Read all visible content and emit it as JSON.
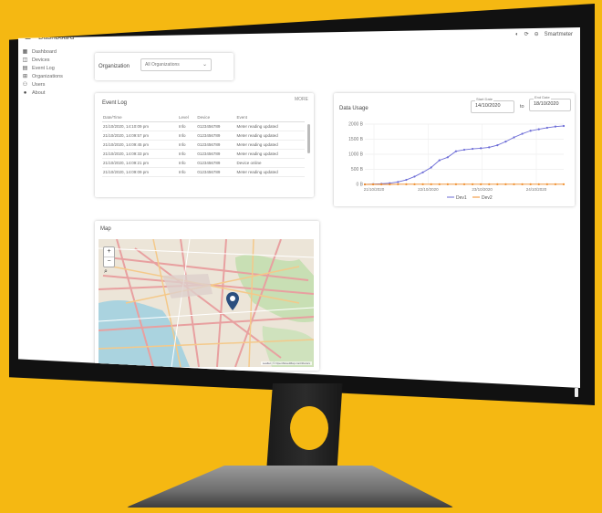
{
  "app": {
    "title": "Dashboard",
    "menu_icon": "menu-icon"
  },
  "topbar": {
    "theme_icon": "contrast-icon",
    "refresh_icon": "refresh-icon",
    "user_icon": "user-icon",
    "user_name": "Smartmeter"
  },
  "sidebar": {
    "items": [
      {
        "label": "Dashboard",
        "icon": "dashboard-icon"
      },
      {
        "label": "Devices",
        "icon": "devices-icon"
      },
      {
        "label": "Event Log",
        "icon": "event-log-icon"
      },
      {
        "label": "Organizations",
        "icon": "organizations-icon"
      },
      {
        "label": "Users",
        "icon": "users-icon"
      },
      {
        "label": "About",
        "icon": "about-icon"
      }
    ]
  },
  "filter": {
    "label": "Organization",
    "selected": "All Organizations"
  },
  "events": {
    "title": "Event Log",
    "more": "MORE",
    "columns": [
      "Date/Time",
      "Level",
      "Device",
      "Event"
    ],
    "rows": [
      [
        "21/10/2020, 14:10:09 pm",
        "Info",
        "0123456789",
        "Meter reading updated"
      ],
      [
        "21/10/2020, 14:09:57 pm",
        "Info",
        "0123456789",
        "Meter reading updated"
      ],
      [
        "21/10/2020, 14:09:45 pm",
        "Info",
        "0123456789",
        "Meter reading updated"
      ],
      [
        "21/10/2020, 14:09:33 pm",
        "Info",
        "0123456789",
        "Meter reading updated"
      ],
      [
        "21/10/2020, 14:09:21 pm",
        "Info",
        "0123456789",
        "Device online"
      ],
      [
        "21/10/2020, 14:09:09 pm",
        "Info",
        "0123456789",
        "Meter reading updated"
      ]
    ]
  },
  "usage": {
    "title": "Data Usage",
    "start_caption": "Start Date",
    "start_date": "14/10/2020",
    "to": "to",
    "end_caption": "End Date",
    "end_date": "18/10/2020"
  },
  "chart_data": {
    "type": "line",
    "title": "Data Usage",
    "x": [
      "21/10/2020",
      "22/10/2020",
      "23/10/2020",
      "24/10/2020"
    ],
    "y_ticks": [
      "0 B",
      "500 B",
      "1000 B",
      "1500 B",
      "2000 B"
    ],
    "ylim": [
      0,
      2000
    ],
    "legend_position": "bottom",
    "series": [
      {
        "name": "Dev1",
        "color": "#6b6bd6",
        "values": [
          0,
          10,
          20,
          40,
          80,
          150,
          260,
          400,
          560,
          800,
          900,
          1100,
          1150,
          1180,
          1200,
          1230,
          1300,
          1420,
          1560,
          1680,
          1780,
          1830,
          1880,
          1920,
          1940
        ]
      },
      {
        "name": "Dev2",
        "color": "#f08c28",
        "values": [
          0,
          0,
          0,
          0,
          5,
          5,
          5,
          5,
          5,
          5,
          5,
          5,
          5,
          5,
          5,
          5,
          5,
          5,
          5,
          5,
          5,
          5,
          5,
          5,
          5
        ]
      }
    ]
  },
  "map": {
    "title": "Map",
    "zoom_in": "+",
    "zoom_out": "−",
    "attribution": "Leaflet | © OpenStreetMap contributors",
    "marker_icon": "map-marker-icon",
    "search_icon": "search-icon"
  }
}
